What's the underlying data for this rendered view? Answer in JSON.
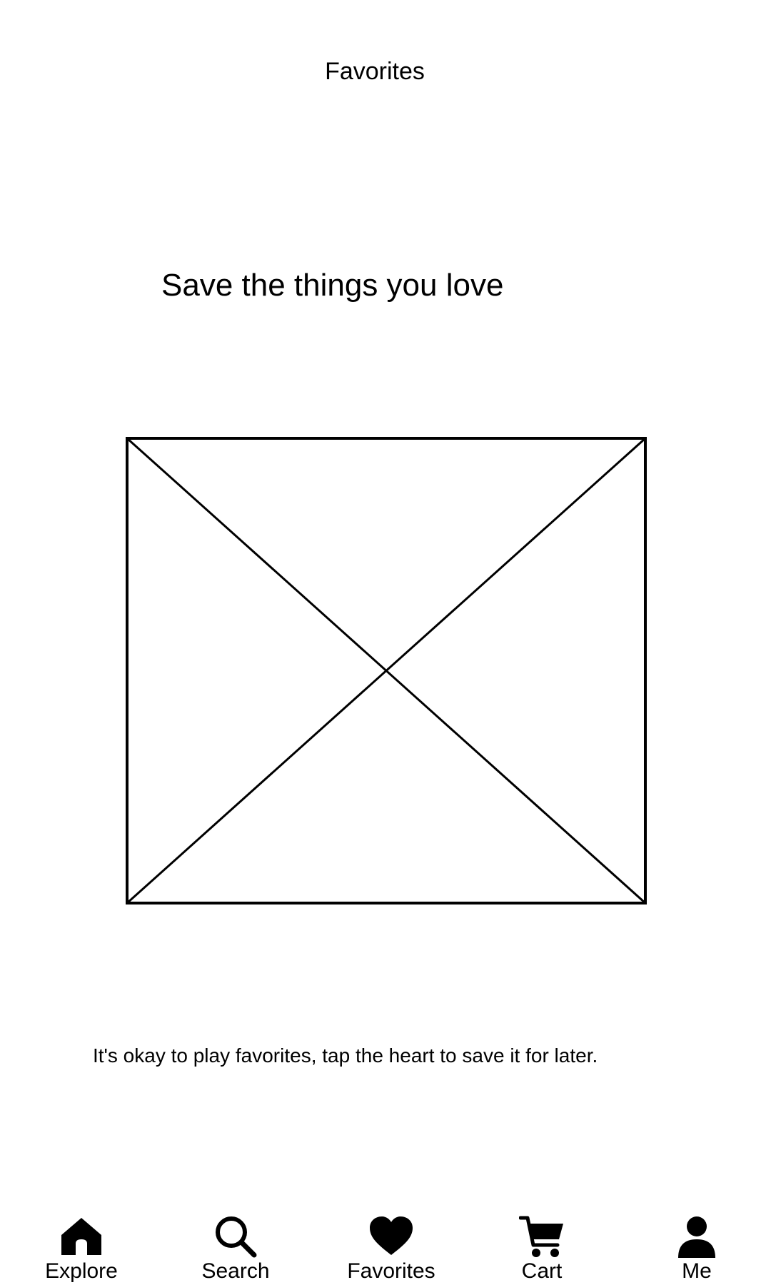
{
  "header": {
    "title": "Favorites"
  },
  "empty_state": {
    "headline": "Save the things you love",
    "image_placeholder": "image-placeholder",
    "hint": "It's okay to play favorites, tap the heart to save it for later."
  },
  "tabbar": {
    "items": [
      {
        "label": "Explore",
        "icon": "home-icon"
      },
      {
        "label": "Search",
        "icon": "search-icon"
      },
      {
        "label": "Favorites",
        "icon": "heart-icon"
      },
      {
        "label": "Cart",
        "icon": "cart-icon"
      },
      {
        "label": "Me",
        "icon": "person-icon"
      }
    ]
  },
  "colors": {
    "background": "#ffffff",
    "foreground": "#000000"
  }
}
